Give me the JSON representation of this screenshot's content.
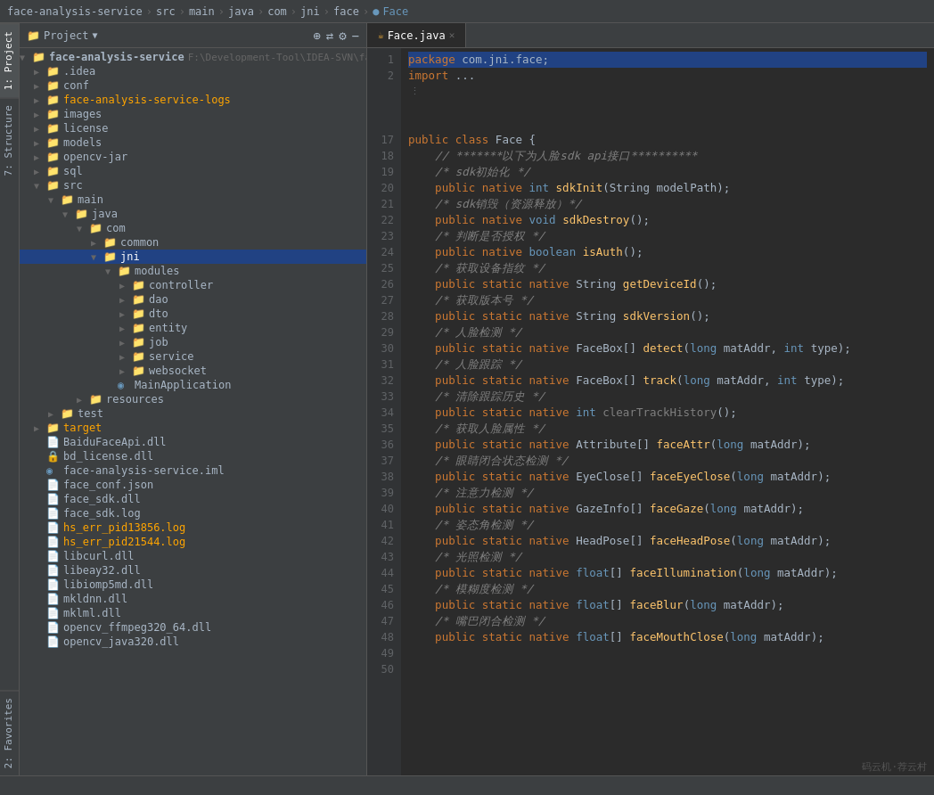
{
  "breadcrumb": {
    "items": [
      "face-analysis-service",
      "src",
      "main",
      "java",
      "com",
      "jni",
      "face"
    ],
    "current": "Face"
  },
  "project_panel": {
    "title": "Project",
    "root": {
      "name": "face-analysis-service",
      "path": "F:\\Development-Tool\\IDEA-SVN\\fa",
      "children": [
        {
          "name": ".idea",
          "type": "folder",
          "indent": 1,
          "expanded": false
        },
        {
          "name": "conf",
          "type": "folder",
          "indent": 1,
          "expanded": false
        },
        {
          "name": "face-analysis-service-logs",
          "type": "folder",
          "indent": 1,
          "expanded": false,
          "highlighted": true
        },
        {
          "name": "images",
          "type": "folder",
          "indent": 1,
          "expanded": false
        },
        {
          "name": "license",
          "type": "folder",
          "indent": 1,
          "expanded": false
        },
        {
          "name": "models",
          "type": "folder",
          "indent": 1,
          "expanded": false
        },
        {
          "name": "opencv-jar",
          "type": "folder",
          "indent": 1,
          "expanded": false
        },
        {
          "name": "sql",
          "type": "folder",
          "indent": 1,
          "expanded": false
        },
        {
          "name": "src",
          "type": "folder-src",
          "indent": 1,
          "expanded": true
        },
        {
          "name": "main",
          "type": "folder",
          "indent": 2,
          "expanded": true
        },
        {
          "name": "java",
          "type": "folder-blue",
          "indent": 3,
          "expanded": true
        },
        {
          "name": "com",
          "type": "folder",
          "indent": 4,
          "expanded": true
        },
        {
          "name": "common",
          "type": "folder",
          "indent": 5,
          "expanded": false
        },
        {
          "name": "jni",
          "type": "folder",
          "indent": 5,
          "expanded": true,
          "selected": true
        },
        {
          "name": "modules",
          "type": "folder",
          "indent": 6,
          "expanded": true
        },
        {
          "name": "controller",
          "type": "folder",
          "indent": 7,
          "expanded": false
        },
        {
          "name": "dao",
          "type": "folder",
          "indent": 7,
          "expanded": false
        },
        {
          "name": "dto",
          "type": "folder",
          "indent": 7,
          "expanded": false
        },
        {
          "name": "entity",
          "type": "folder",
          "indent": 7,
          "expanded": false
        },
        {
          "name": "job",
          "type": "folder",
          "indent": 7,
          "expanded": false
        },
        {
          "name": "service",
          "type": "folder",
          "indent": 7,
          "expanded": false
        },
        {
          "name": "websocket",
          "type": "folder",
          "indent": 7,
          "expanded": false
        },
        {
          "name": "MainApplication",
          "type": "java",
          "indent": 6
        },
        {
          "name": "resources",
          "type": "folder",
          "indent": 4,
          "expanded": false
        },
        {
          "name": "test",
          "type": "folder",
          "indent": 2,
          "expanded": false
        },
        {
          "name": "target",
          "type": "folder",
          "indent": 1,
          "expanded": false,
          "highlighted": true
        },
        {
          "name": "BaiduFaceApi.dll",
          "type": "dll",
          "indent": 1
        },
        {
          "name": "bd_license.dll",
          "type": "dll",
          "indent": 1
        },
        {
          "name": "face-analysis-service.iml",
          "type": "iml",
          "indent": 1
        },
        {
          "name": "face_conf.json",
          "type": "config",
          "indent": 1
        },
        {
          "name": "face_sdk.dll",
          "type": "dll",
          "indent": 1
        },
        {
          "name": "face_sdk.log",
          "type": "log",
          "indent": 1
        },
        {
          "name": "hs_err_pid13856.log",
          "type": "log",
          "indent": 1,
          "highlighted": true
        },
        {
          "name": "hs_err_pid21544.log",
          "type": "log",
          "indent": 1,
          "highlighted": true
        },
        {
          "name": "libcurl.dll",
          "type": "dll",
          "indent": 1
        },
        {
          "name": "libeay32.dll",
          "type": "dll",
          "indent": 1
        },
        {
          "name": "libiomp5md.dll",
          "type": "dll",
          "indent": 1
        },
        {
          "name": "mkldnn.dll",
          "type": "dll",
          "indent": 1
        },
        {
          "name": "mklml.dll",
          "type": "dll",
          "indent": 1
        },
        {
          "name": "opencv_ffmpeg320_64.dll",
          "type": "dll",
          "indent": 1
        },
        {
          "name": "opencv_java320.dll",
          "type": "dll",
          "indent": 1
        }
      ]
    }
  },
  "editor": {
    "tab": {
      "name": "Face.java",
      "icon": "java"
    },
    "lines": [
      {
        "num": 1,
        "content": "package_line"
      },
      {
        "num": 2,
        "content": "import_line"
      },
      {
        "num": 17,
        "content": "empty"
      },
      {
        "num": 18,
        "content": "empty"
      },
      {
        "num": 19,
        "content": "class_line"
      },
      {
        "num": 20,
        "content": "comment_sdk_api"
      },
      {
        "num": 21,
        "content": "comment_sdk_init_title"
      },
      {
        "num": 22,
        "content": "method_sdk_init"
      },
      {
        "num": 23,
        "content": "comment_sdk_destroy_title"
      },
      {
        "num": 24,
        "content": "method_sdk_destroy"
      },
      {
        "num": 25,
        "content": "comment_is_auth"
      },
      {
        "num": 26,
        "content": "method_is_auth"
      },
      {
        "num": 27,
        "content": "comment_get_device"
      },
      {
        "num": 28,
        "content": "method_get_device"
      },
      {
        "num": 29,
        "content": "comment_get_version"
      },
      {
        "num": 30,
        "content": "method_sdk_version"
      },
      {
        "num": 31,
        "content": "comment_face_detect"
      },
      {
        "num": 32,
        "content": "method_detect"
      },
      {
        "num": 33,
        "content": "comment_face_track"
      },
      {
        "num": 34,
        "content": "method_track"
      },
      {
        "num": 35,
        "content": "comment_clear_track"
      },
      {
        "num": 36,
        "content": "method_clear_track"
      },
      {
        "num": 37,
        "content": "comment_face_attr"
      },
      {
        "num": 38,
        "content": "method_face_attr"
      },
      {
        "num": 39,
        "content": "comment_eye_close"
      },
      {
        "num": 40,
        "content": "method_eye_close"
      },
      {
        "num": 41,
        "content": "comment_gaze"
      },
      {
        "num": 42,
        "content": "method_gaze"
      },
      {
        "num": 43,
        "content": "comment_head_pose"
      },
      {
        "num": 44,
        "content": "method_head_pose"
      },
      {
        "num": 45,
        "content": "comment_illumination"
      },
      {
        "num": 46,
        "content": "method_illumination"
      },
      {
        "num": 47,
        "content": "comment_blur"
      },
      {
        "num": 48,
        "content": "method_blur"
      },
      {
        "num": 49,
        "content": "comment_mouth"
      },
      {
        "num": 50,
        "content": "method_mouth"
      }
    ]
  },
  "side_tabs": [
    {
      "id": "project",
      "label": "1: Project",
      "active": true
    },
    {
      "id": "structure",
      "label": "7: Structure",
      "active": false
    },
    {
      "id": "favorites",
      "label": "2: Favorites",
      "active": false
    }
  ],
  "watermark": "码云机·荐云村"
}
